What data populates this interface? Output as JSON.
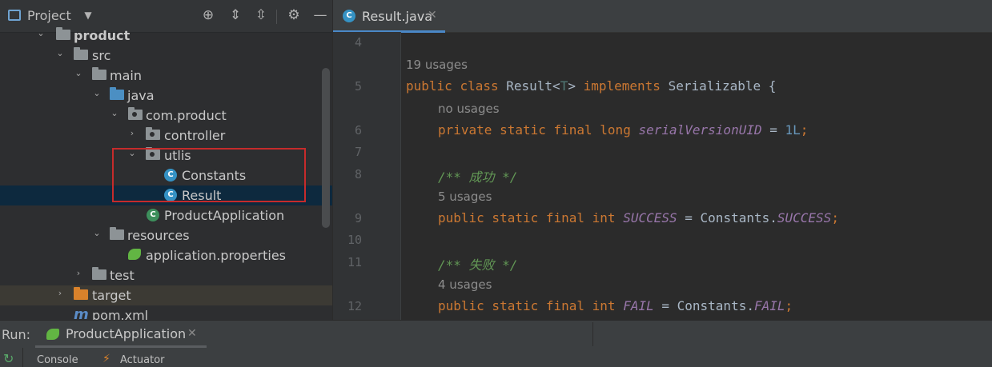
{
  "project_panel": {
    "title": "Project",
    "toolbar_icons": [
      "crosshair-icon",
      "expand-all-icon",
      "collapse-all-icon",
      "gear-icon",
      "minimize-icon"
    ]
  },
  "tree": [
    {
      "label": "product",
      "icon": "module-folder",
      "depth": 0
    },
    {
      "label": "src",
      "icon": "folder",
      "depth": 1
    },
    {
      "label": "main",
      "icon": "folder",
      "depth": 2
    },
    {
      "label": "java",
      "icon": "source-folder",
      "depth": 3
    },
    {
      "label": "com.product",
      "icon": "package",
      "depth": 4
    },
    {
      "label": "controller",
      "icon": "package",
      "depth": 5
    },
    {
      "label": "utlis",
      "icon": "package",
      "depth": 5
    },
    {
      "label": "Constants",
      "icon": "class",
      "depth": 6
    },
    {
      "label": "Result",
      "icon": "class",
      "depth": 6
    },
    {
      "label": "ProductApplication",
      "icon": "spring-class",
      "depth": 5
    },
    {
      "label": "resources",
      "icon": "resources-folder",
      "depth": 3
    },
    {
      "label": "application.properties",
      "icon": "spring-properties",
      "depth": 4
    },
    {
      "label": "test",
      "icon": "folder",
      "depth": 2
    },
    {
      "label": "target",
      "icon": "excluded-folder",
      "depth": 1
    },
    {
      "label": "pom.xml",
      "icon": "maven",
      "depth": 1
    }
  ],
  "editor": {
    "tab_label": "Result.java",
    "tab_icon_letter": "C",
    "line_numbers": [
      "4",
      "5",
      "6",
      "7",
      "8",
      "9",
      "10",
      "11",
      "12"
    ],
    "hints": {
      "usages_19": "19 usages",
      "no_usages": "no usages",
      "usages_5": "5 usages",
      "usages_4": "4 usages"
    },
    "code": {
      "l5_kw1": "public",
      "l5_kw2": "class",
      "l5_name": "Result<",
      "l5_type": "T",
      "l5_close": ">",
      "l5_kw3": "implements",
      "l5_iface": "Serializable {",
      "l6_kw": "private static final long",
      "l6_field": "serialVersionUID",
      "l6_eq": " = ",
      "l6_num": "1L",
      "l6_semi": ";",
      "l8_comment": "/** 成功 */",
      "l9_kw": "public static final int",
      "l9_field": "SUCCESS",
      "l9_mid": " = Constants.",
      "l9_ref": "SUCCESS",
      "l9_semi": ";",
      "l11_comment": "/** 失败 */",
      "l12_kw": "public static final int",
      "l12_field": "FAIL",
      "l12_mid": " = Constants.",
      "l12_ref": "FAIL",
      "l12_semi": ";"
    }
  },
  "run_bar": {
    "label": "Run:",
    "tab_label": "ProductApplication",
    "console_label": "Console",
    "actuator_label": "Actuator"
  }
}
